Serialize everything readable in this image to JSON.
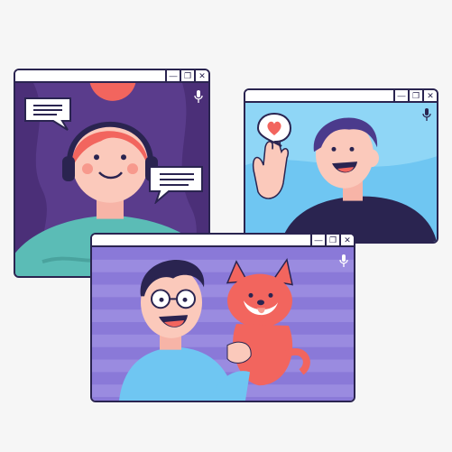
{
  "windows": [
    {
      "name": "left-call-window",
      "controls": {
        "minimize": "—",
        "restore": "❐",
        "close": "✕"
      }
    },
    {
      "name": "right-call-window",
      "controls": {
        "minimize": "—",
        "restore": "❐",
        "close": "✕"
      }
    },
    {
      "name": "front-call-window",
      "controls": {
        "minimize": "—",
        "restore": "❐",
        "close": "✕"
      }
    }
  ],
  "icons": {
    "mic": "microphone-icon",
    "chat": "speech-bubble-icon",
    "heart": "heart-icon"
  },
  "colors": {
    "outline": "#2a2450",
    "purple": "#5a3c8c",
    "coral": "#f2655e",
    "sky": "#6fc6f2",
    "teal": "#5bbcb6",
    "violet": "#8a79d8"
  }
}
